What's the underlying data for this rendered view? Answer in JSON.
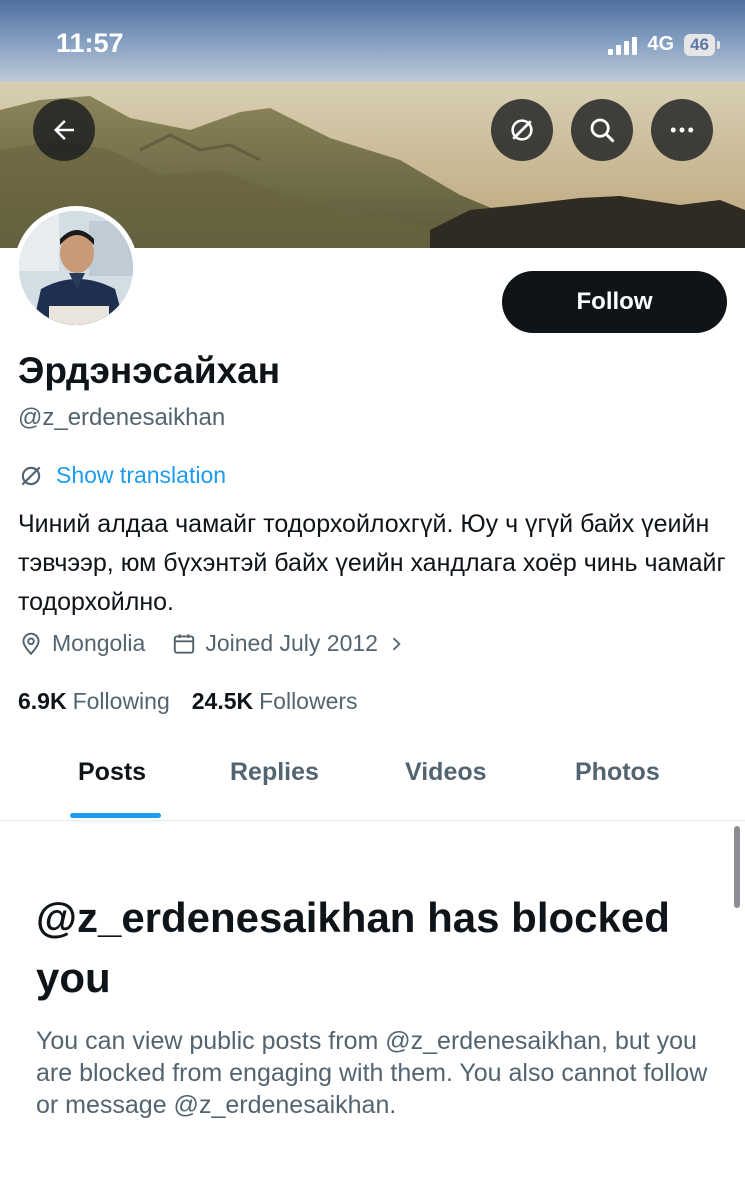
{
  "status_bar": {
    "time": "11:57",
    "network": "4G",
    "battery": "46"
  },
  "header": {
    "back_icon": "back-arrow-icon",
    "actions": [
      "translate-off-icon",
      "search-icon",
      "more-icon"
    ]
  },
  "profile": {
    "name": "Эрдэнэсайхан",
    "handle": "@z_erdenesaikhan",
    "follow_label": "Follow",
    "translation_label": "Show translation",
    "bio": "Чиний алдаа чамайг тодорхойлохгүй. Юу ч үгүй байх үеийн тэвчээр, юм бүхэнтэй байх үеийн хандлага хоёр чинь чамайг тодорхойлно.",
    "location": "Mongolia",
    "joined": "Joined July 2012",
    "following_count": "6.9K",
    "following_label": "Following",
    "followers_count": "24.5K",
    "followers_label": "Followers"
  },
  "tabs": [
    {
      "label": "Posts",
      "active": true
    },
    {
      "label": "Replies",
      "active": false
    },
    {
      "label": "Videos",
      "active": false
    },
    {
      "label": "Photos",
      "active": false
    }
  ],
  "blocked": {
    "title": "@z_erdenesaikhan has blocked you",
    "description": "You can view public posts from @z_erdenesaikhan, but you are blocked from engaging with them. You also cannot follow or message @z_erdenesaikhan."
  },
  "colors": {
    "accent": "#1d9bf0",
    "text": "#0f1419",
    "secondary": "#536471",
    "button": "#0f1419"
  }
}
